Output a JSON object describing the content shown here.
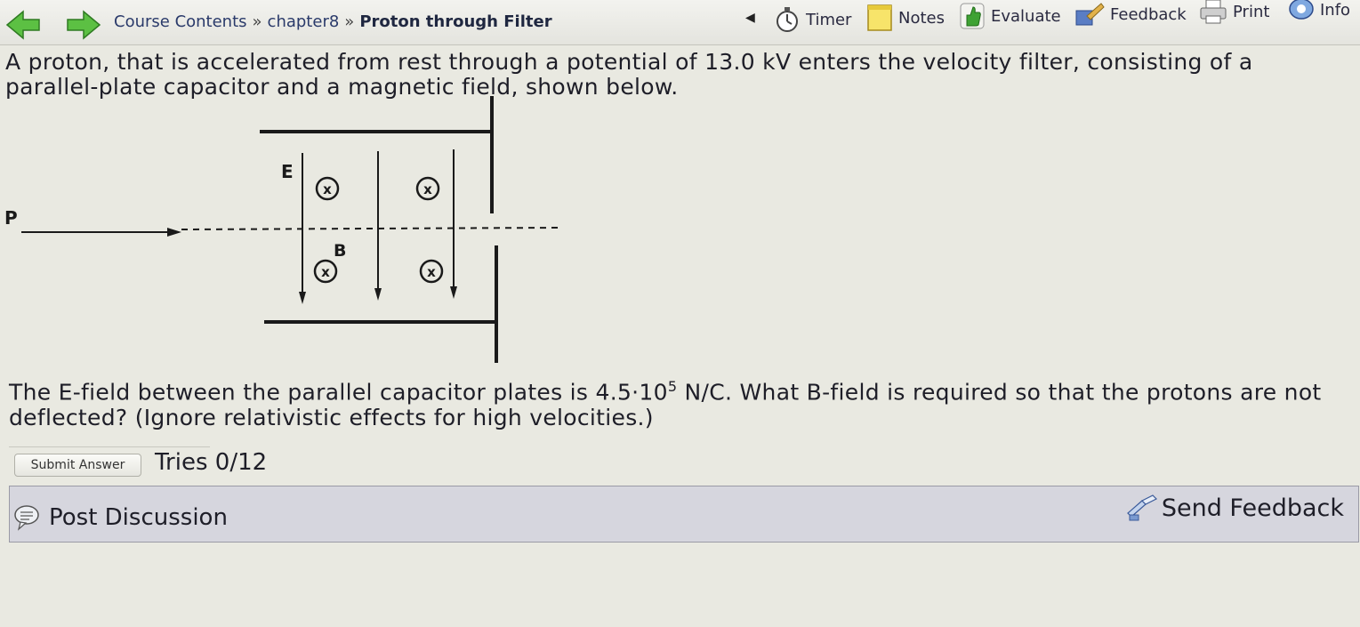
{
  "nav": {
    "breadcrumb": [
      "Course Contents",
      "chapter8",
      "Proton through Filter"
    ],
    "separator": "»"
  },
  "toolbar": {
    "timer": "Timer",
    "notes": "Notes",
    "evaluate": "Evaluate",
    "feedback": "Feedback",
    "print": "Print",
    "info": "Info"
  },
  "question": {
    "intro": "A proton, that is accelerated from rest through a potential of 13.0 kV enters the velocity filter, consisting of a parallel-plate capacitor and a magnetic field, shown below.",
    "followup_pre": "The E-field between the parallel capacitor plates is 4.5·10",
    "followup_exp": "5",
    "followup_post": " N/C. What B-field is required so that the protons are not deflected? (Ignore relativistic effects for high velocities.)"
  },
  "diagram": {
    "label_p": "P",
    "label_e": "E",
    "label_b": "B",
    "field_symbol": "x"
  },
  "answer": {
    "value": "",
    "submit_label": "Submit Answer",
    "tries": "Tries 0/12"
  },
  "footer": {
    "post_discussion": "Post Discussion",
    "send_feedback": "Send Feedback"
  },
  "colors": {
    "nav_arrow": "#4fb53c",
    "breadcrumb_link": "#2a3a6a",
    "discussion_bar": "#d6d6de"
  }
}
